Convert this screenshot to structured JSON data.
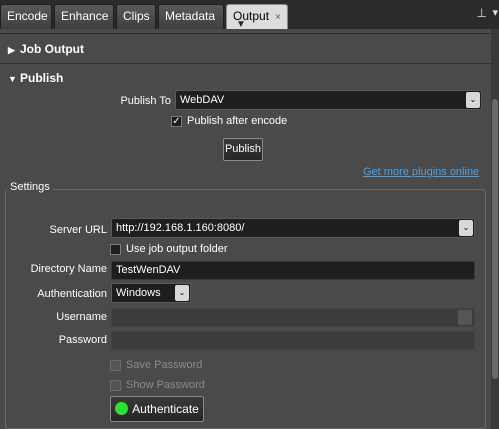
{
  "tabs": [
    {
      "label": "Encode"
    },
    {
      "label": "Enhance"
    },
    {
      "label": "Clips"
    },
    {
      "label": "Metadata"
    },
    {
      "label": "Output",
      "active": true
    }
  ],
  "tab_close_glyph": "×",
  "icons": {
    "pin": "pin-icon",
    "window_menu": "window-menu-icon"
  },
  "sections": {
    "job_output": {
      "title": "Job Output",
      "expanded": false
    },
    "publish": {
      "title": "Publish",
      "expanded": true
    }
  },
  "publish": {
    "publish_to_label": "Publish To",
    "publish_to_value": "WebDAV",
    "publish_after_encode_label": "Publish after encode",
    "publish_after_encode_checked": true,
    "publish_button": "Publish",
    "plugins_link": "Get more plugins online"
  },
  "settings": {
    "title": "Settings",
    "server_url_label": "Server URL",
    "server_url_value": "http://192.168.1.160:8080/",
    "use_job_output_folder_label": "Use job output folder",
    "use_job_output_folder_checked": false,
    "directory_name_label": "Directory Name",
    "directory_name_value": "TestWenDAV",
    "authentication_label": "Authentication",
    "authentication_value": "Windows",
    "username_label": "Username",
    "username_value": "",
    "password_label": "Password",
    "password_value": "",
    "save_password_label": "Save Password",
    "show_password_label": "Show Password",
    "authenticate_button": "Authenticate"
  },
  "colors": {
    "accent_link": "#4aa3e8",
    "status_ok": "#2ee12e",
    "panel_bg": "#4a4a4a"
  }
}
